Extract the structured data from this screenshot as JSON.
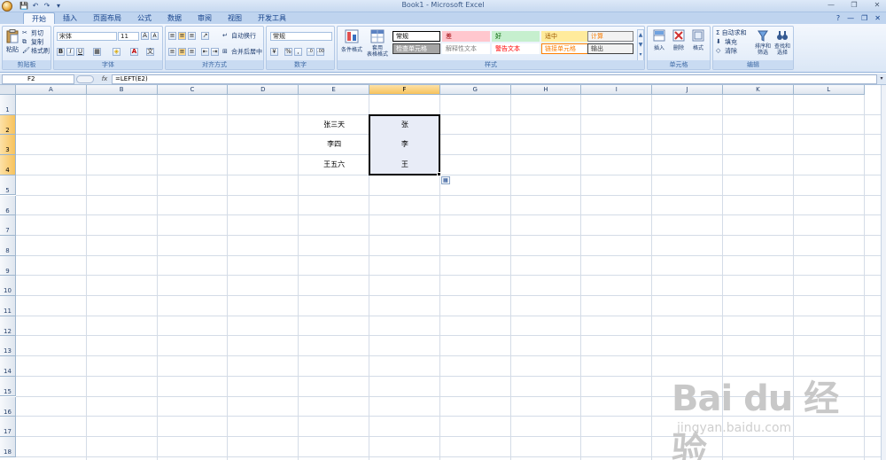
{
  "window": {
    "title": "Book1 - Microsoft Excel",
    "controls": [
      "—",
      "❐",
      "✕"
    ]
  },
  "quick_access": [
    "💾",
    "↶",
    "↷",
    "▾"
  ],
  "tabs": [
    "开始",
    "插入",
    "页面布局",
    "公式",
    "数据",
    "审阅",
    "视图",
    "开发工具"
  ],
  "active_tab": "开始",
  "tabs_right": [
    "?",
    "—",
    "❐",
    "✕"
  ],
  "ribbon": {
    "clipboard": {
      "label": "剪贴板",
      "paste": "粘贴",
      "cut": "剪切",
      "copy": "复制",
      "format_painter": "格式刷"
    },
    "font": {
      "label": "字体",
      "font_name": "宋体",
      "font_size": "11",
      "bold": "B",
      "italic": "I",
      "underline": "U",
      "grow": "A",
      "shrink": "A",
      "font_color_letter": "A"
    },
    "alignment": {
      "label": "对齐方式",
      "wrap_text": "自动换行",
      "merge_center": "合并后居中"
    },
    "number": {
      "label": "数字",
      "format": "常规",
      "percent": "%",
      "comma": ","
    },
    "styles": {
      "label": "样式",
      "conditional": "条件格式",
      "table_format_1": "套用",
      "table_format_2": "表格格式",
      "cells": [
        {
          "text": "常规",
          "bg": "#ffffff",
          "fg": "#000000",
          "border": "#000000"
        },
        {
          "text": "差",
          "bg": "#ffc7ce",
          "fg": "#9c0006",
          "border": "#ffc7ce"
        },
        {
          "text": "好",
          "bg": "#c6efce",
          "fg": "#006100",
          "border": "#c6efce"
        },
        {
          "text": "适中",
          "bg": "#ffeb9c",
          "fg": "#9c5700",
          "border": "#ffeb9c"
        },
        {
          "text": "计算",
          "bg": "#f2f2f2",
          "fg": "#fa7d00",
          "border": "#7f7f7f"
        },
        {
          "text": "检查单元格",
          "bg": "#a5a5a5",
          "fg": "#ffffff",
          "border": "#3f3f3f"
        },
        {
          "text": "解释性文本",
          "bg": "#ffffff",
          "fg": "#7f7f7f",
          "border": "#ffffff"
        },
        {
          "text": "警告文本",
          "bg": "#ffffff",
          "fg": "#ff0000",
          "border": "#ffffff"
        },
        {
          "text": "链接单元格",
          "bg": "#ffffff",
          "fg": "#fa7d00",
          "border": "#ff8001"
        },
        {
          "text": "输出",
          "bg": "#f2f2f2",
          "fg": "#3f3f3f",
          "border": "#3f3f3f"
        }
      ]
    },
    "cells": {
      "label": "单元格",
      "insert": "插入",
      "delete": "删除",
      "format": "格式"
    },
    "editing": {
      "label": "编辑",
      "autosum": "Σ 自动求和",
      "fill": "填充",
      "clear": "清除",
      "sort_1": "排序和",
      "sort_2": "筛选",
      "find_1": "查找和",
      "find_2": "选择"
    }
  },
  "formula_bar": {
    "name_box": "F2",
    "fx": "fx",
    "formula": "=LEFT(E2)"
  },
  "grid": {
    "columns": [
      "A",
      "B",
      "C",
      "D",
      "E",
      "F",
      "G",
      "H",
      "I",
      "J",
      "K",
      "L"
    ],
    "selected_column": "F",
    "rows": [
      "1",
      "2",
      "3",
      "4",
      "5",
      "6",
      "7",
      "8",
      "9",
      "10",
      "11",
      "12",
      "13",
      "14",
      "15",
      "16",
      "17",
      "18"
    ],
    "selected_rows": [
      "2",
      "3",
      "4"
    ],
    "cells": [
      {
        "ref": "E2",
        "value": "张三天"
      },
      {
        "ref": "E3",
        "value": "李四"
      },
      {
        "ref": "E4",
        "value": "王五六"
      },
      {
        "ref": "F2",
        "value": "张"
      },
      {
        "ref": "F3",
        "value": "李"
      },
      {
        "ref": "F4",
        "value": "王"
      }
    ],
    "selection": "F2:F4"
  },
  "watermark": {
    "logo": "Bai du 经验",
    "url": "jingyan.baidu.com"
  }
}
